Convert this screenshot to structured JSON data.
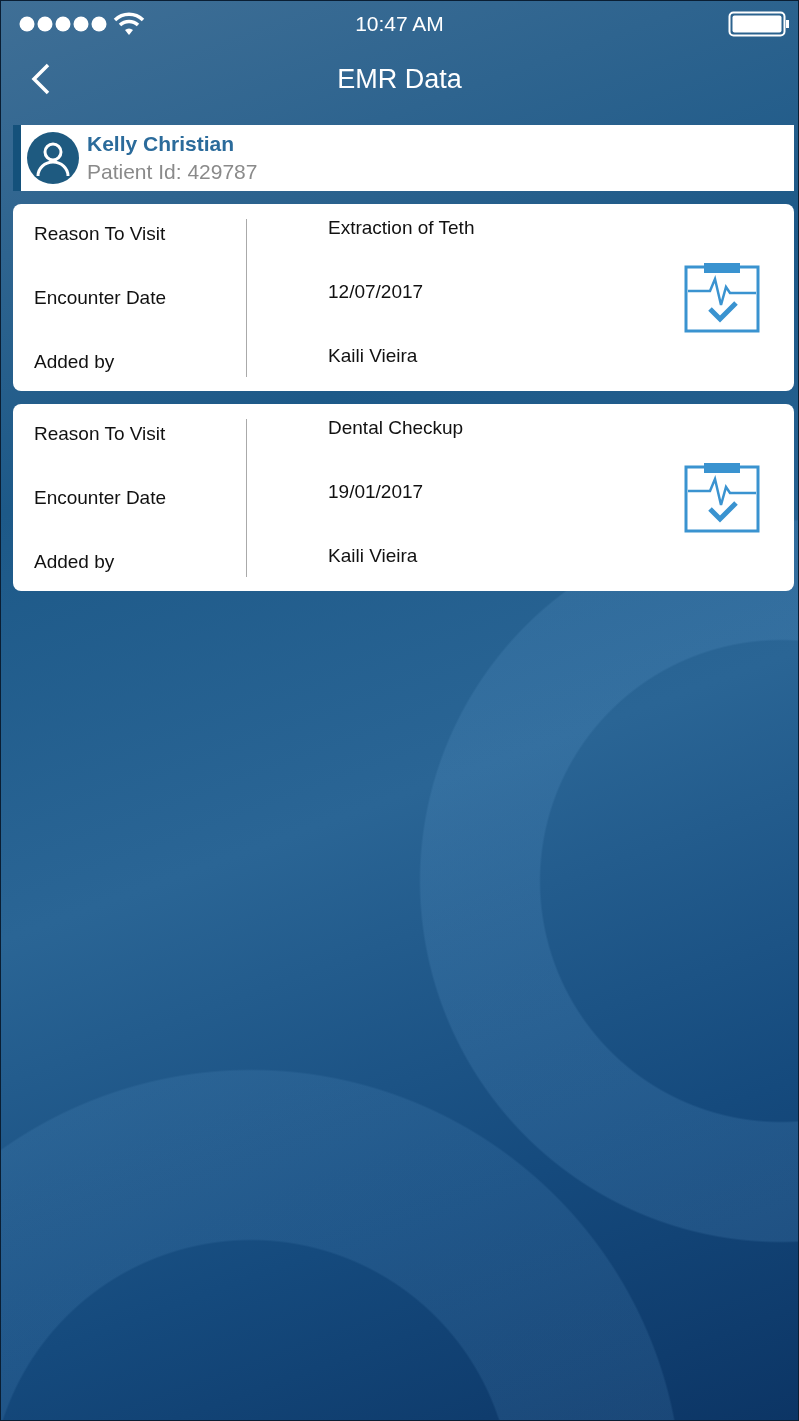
{
  "status_bar": {
    "time": "10:47 AM"
  },
  "nav": {
    "title": "EMR Data"
  },
  "patient": {
    "name": "Kelly Christian",
    "id_text": "Patient Id: 429787"
  },
  "records": [
    {
      "fields": [
        {
          "label": "Reason To Visit",
          "value": "Extraction of Teth"
        },
        {
          "label": "Encounter Date",
          "value": "12/07/2017"
        },
        {
          "label": "Added by",
          "value": "Kaili Vieira"
        }
      ]
    },
    {
      "fields": [
        {
          "label": "Reason To Visit",
          "value": "Dental Checkup"
        },
        {
          "label": "Encounter Date",
          "value": "19/01/2017"
        },
        {
          "label": "Added by",
          "value": "Kaili Vieira"
        }
      ]
    }
  ]
}
